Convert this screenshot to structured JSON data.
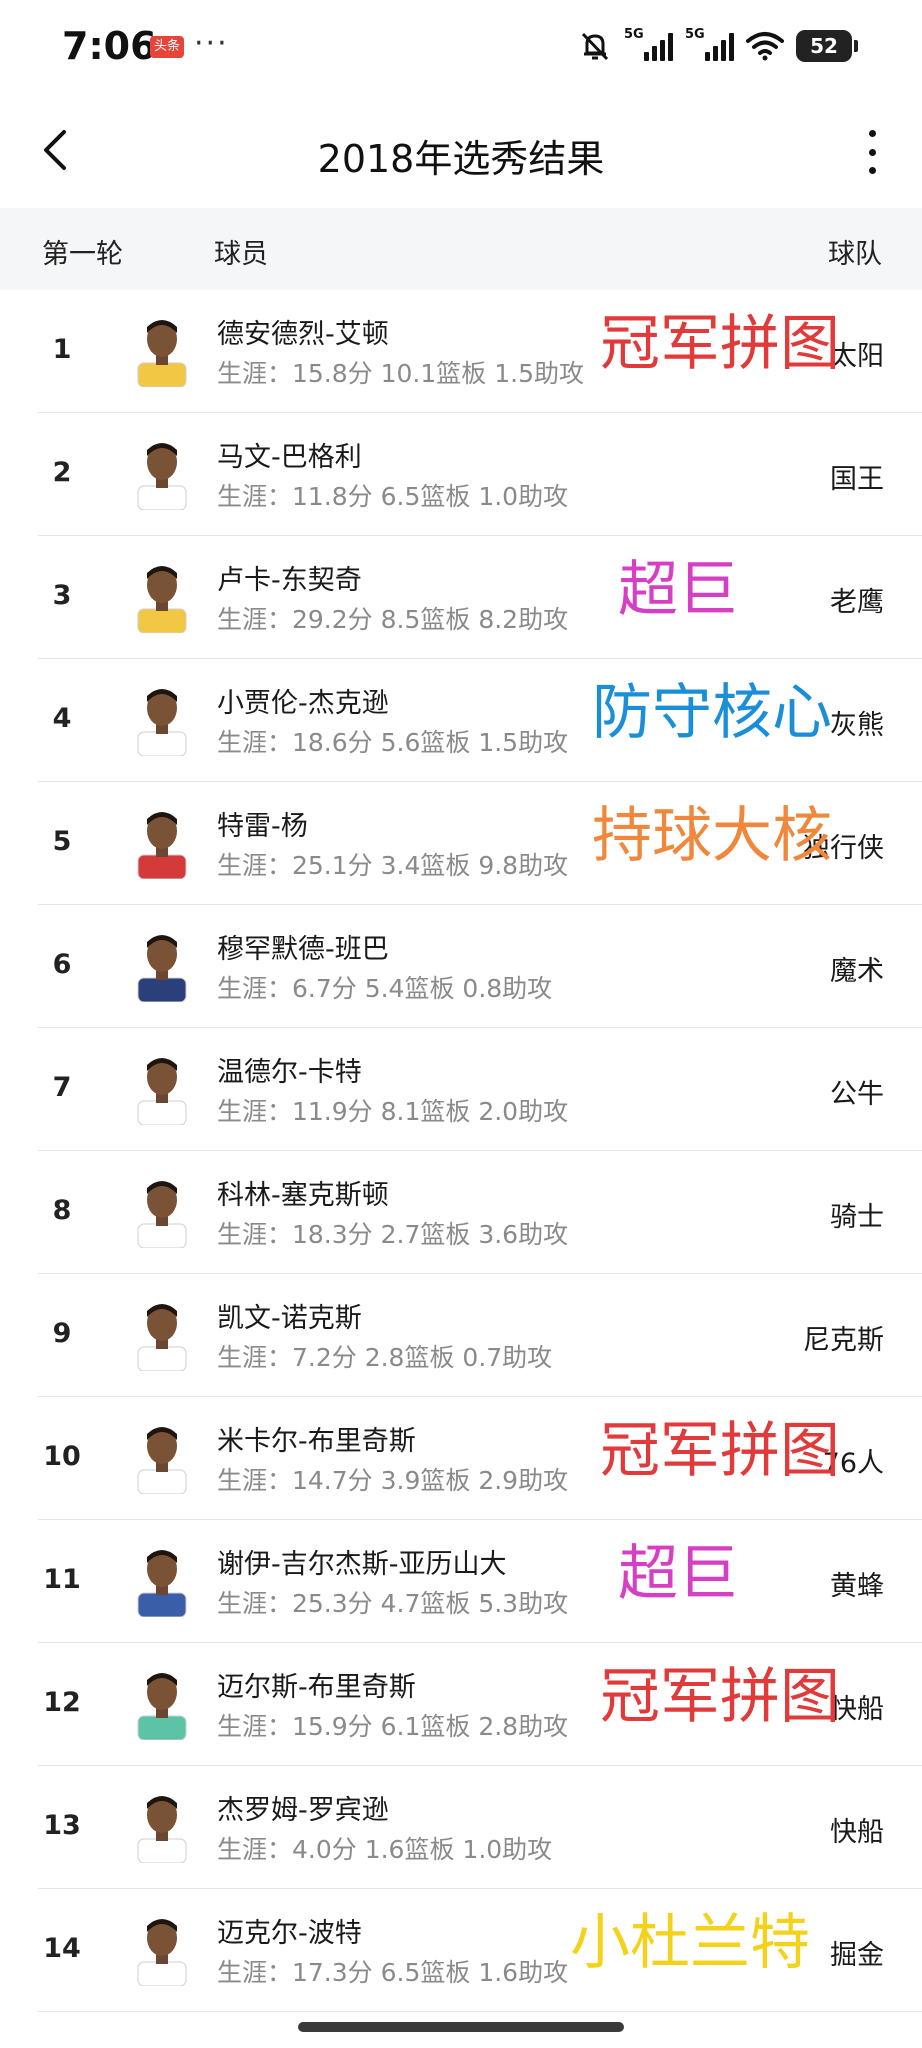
{
  "status_bar": {
    "time": "7:06",
    "app_badge": "头条",
    "dots": "···",
    "signal1_label": "5G",
    "signal2_label": "5G",
    "battery": "52"
  },
  "nav": {
    "title": "2018年选秀结果"
  },
  "table_header": {
    "round": "第一轮",
    "player": "球员",
    "team": "球队"
  },
  "rows": [
    {
      "rank": "1",
      "name": "德安德烈-艾顿",
      "stats": "生涯：15.8分 10.1篮板 1.5助攻",
      "team": "太阳",
      "tag": "冠军拼图",
      "tag_color": "#e03a3a",
      "jersey": "#f2c744"
    },
    {
      "rank": "2",
      "name": "马文-巴格利",
      "stats": "生涯：11.8分 6.5篮板 1.0助攻",
      "team": "国王",
      "tag": "",
      "tag_color": "",
      "jersey": "#ffffff"
    },
    {
      "rank": "3",
      "name": "卢卡-东契奇",
      "stats": "生涯：29.2分 8.5篮板 8.2助攻",
      "team": "老鹰",
      "tag": "超巨",
      "tag_color": "#d63fc4",
      "jersey": "#f2c744"
    },
    {
      "rank": "4",
      "name": "小贾伦-杰克逊",
      "stats": "生涯：18.6分 5.6篮板 1.5助攻",
      "team": "灰熊",
      "tag": "防守核心",
      "tag_color": "#1a8fd8",
      "jersey": "#ffffff"
    },
    {
      "rank": "5",
      "name": "特雷-杨",
      "stats": "生涯：25.1分 3.4篮板 9.8助攻",
      "team": "独行侠",
      "tag": "持球大核",
      "tag_color": "#f0873a",
      "jersey": "#d53a3a"
    },
    {
      "rank": "6",
      "name": "穆罕默德-班巴",
      "stats": "生涯：6.7分 5.4篮板 0.8助攻",
      "team": "魔术",
      "tag": "",
      "tag_color": "",
      "jersey": "#2b3f7a"
    },
    {
      "rank": "7",
      "name": "温德尔-卡特",
      "stats": "生涯：11.9分 8.1篮板 2.0助攻",
      "team": "公牛",
      "tag": "",
      "tag_color": "",
      "jersey": "#ffffff"
    },
    {
      "rank": "8",
      "name": "科林-塞克斯顿",
      "stats": "生涯：18.3分 2.7篮板 3.6助攻",
      "team": "骑士",
      "tag": "",
      "tag_color": "",
      "jersey": "#ffffff"
    },
    {
      "rank": "9",
      "name": "凯文-诺克斯",
      "stats": "生涯：7.2分 2.8篮板 0.7助攻",
      "team": "尼克斯",
      "tag": "",
      "tag_color": "",
      "jersey": "#ffffff"
    },
    {
      "rank": "10",
      "name": "米卡尔-布里奇斯",
      "stats": "生涯：14.7分 3.9篮板 2.9助攻",
      "team": "76人",
      "tag": "冠军拼图",
      "tag_color": "#e03a3a",
      "jersey": "#ffffff"
    },
    {
      "rank": "11",
      "name": "谢伊-吉尔杰斯-亚历山大",
      "stats": "生涯：25.3分 4.7篮板 5.3助攻",
      "team": "黄蜂",
      "tag": "超巨",
      "tag_color": "#d63fc4",
      "jersey": "#3a5fa8"
    },
    {
      "rank": "12",
      "name": "迈尔斯-布里奇斯",
      "stats": "生涯：15.9分 6.1篮板 2.8助攻",
      "team": "快船",
      "tag": "冠军拼图",
      "tag_color": "#e03a3a",
      "jersey": "#5cc3a6"
    },
    {
      "rank": "13",
      "name": "杰罗姆-罗宾逊",
      "stats": "生涯：4.0分 1.6篮板 1.0助攻",
      "team": "快船",
      "tag": "",
      "tag_color": "",
      "jersey": "#ffffff"
    },
    {
      "rank": "14",
      "name": "迈克尔-波特",
      "stats": "生涯：17.3分 6.5篮板 1.6助攻",
      "team": "掘金",
      "tag": "小杜兰特",
      "tag_color": "#f5d21a",
      "jersey": "#ffffff"
    }
  ]
}
